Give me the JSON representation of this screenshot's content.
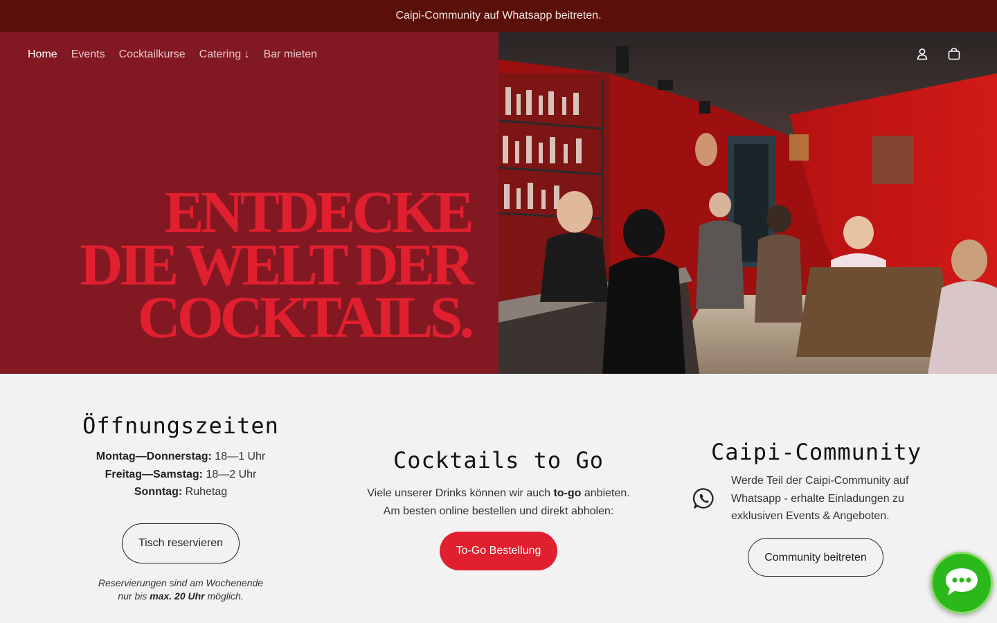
{
  "announcement": {
    "text": "Caipi-Community auf Whatsapp beitreten."
  },
  "nav": {
    "home": "Home",
    "events": "Events",
    "cocktailkurse": "Cocktailkurse",
    "catering": "Catering ↓",
    "bar_mieten": "Bar mieten"
  },
  "header_icons": {
    "account": "account-icon",
    "cart": "cart-icon"
  },
  "hero": {
    "line1": "ENTDECKE",
    "line2": "DIE WELT DER",
    "line3": "COCKTAILS.",
    "image": "bar-interior-photo"
  },
  "hours": {
    "title": "Öffnungszeiten",
    "row1_label": "Montag—Donnerstag:",
    "row1_value": " 18—1 Uhr",
    "row2_label": "Freitag—Samstag:",
    "row2_value": " 18—2 Uhr",
    "row3_label": "Sonntag:",
    "row3_value": " Ruhetag",
    "button": "Tisch reservieren",
    "note_a": "Reservierungen sind am Wochenende",
    "note_b": "nur bis ",
    "note_bold": "max. 20 Uhr",
    "note_c": " möglich."
  },
  "togo": {
    "title": "Cocktails to Go",
    "text_a": "Viele unserer Drinks können wir auch ",
    "text_bold": "to-go",
    "text_b": " anbieten.",
    "text_line2": "Am besten online bestellen und direkt abholen:",
    "button": "To-Go Bestellung"
  },
  "community": {
    "title": "Caipi-Community",
    "text_line1": "Werde Teil der Caipi-Community auf",
    "text_line2": "Whatsapp - erhalte Einladungen zu",
    "text_line3": "exklusiven Events & Angeboten.",
    "button": "Community beitreten",
    "icon": "whatsapp-icon"
  },
  "chat": {
    "icon": "chat-bubble-icon"
  },
  "colors": {
    "announcement_bg": "#5a1008",
    "hero_bg": "#821822",
    "accent_red": "#e01f2f",
    "page_bg": "#f2f2f2",
    "chat_green": "#2ab81a"
  }
}
